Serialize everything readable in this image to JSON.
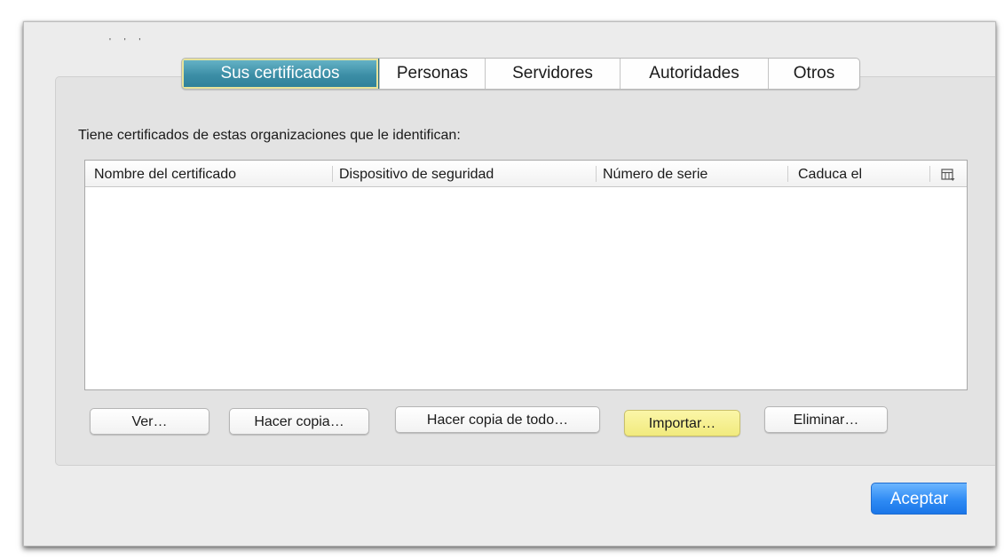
{
  "tabs": [
    {
      "label": "Sus certificados",
      "selected": true
    },
    {
      "label": "Personas",
      "selected": false
    },
    {
      "label": "Servidores",
      "selected": false
    },
    {
      "label": "Autoridades",
      "selected": false
    },
    {
      "label": "Otros",
      "selected": false
    }
  ],
  "description": "Tiene certificados de estas organizaciones que le identifican:",
  "table": {
    "columns": [
      "Nombre del certificado",
      "Dispositivo de seguridad",
      "Número de serie",
      "Caduca el"
    ],
    "rows": [],
    "column_picker_icon": "column-picker-icon"
  },
  "buttons": {
    "view": "Ver…",
    "backup": "Hacer copia…",
    "backup_all": "Hacer copia de todo…",
    "import": "Importar…",
    "delete": "Eliminar…",
    "ok": "Aceptar"
  },
  "colors": {
    "selected_tab": "#3c8ea6",
    "focus_highlight": "#f1ea7e",
    "default_button": "#2f8bf4"
  }
}
